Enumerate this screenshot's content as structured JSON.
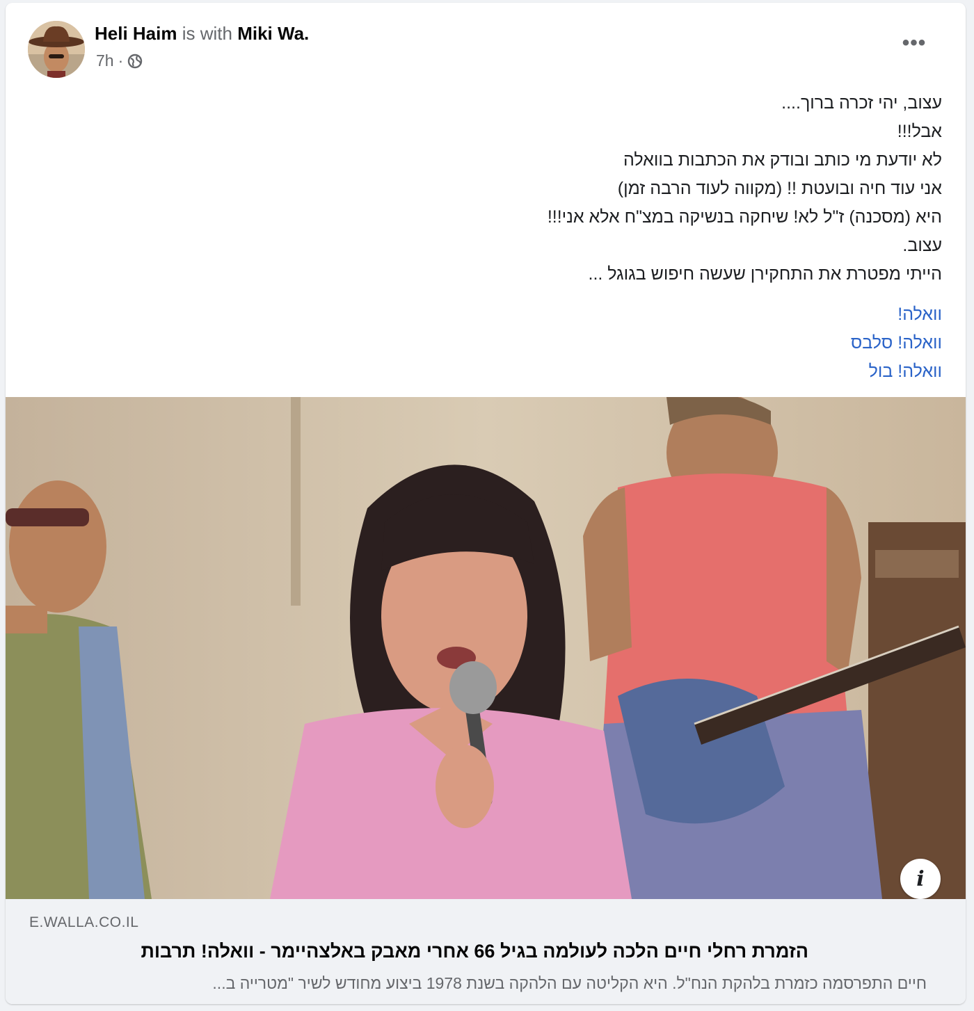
{
  "post": {
    "author": "Heli Haim",
    "with_text": "is with",
    "tagged": "Miki Wa.",
    "time": "7h",
    "separator": "·",
    "privacy_icon": "globe-icon",
    "more_icon": "more-horizontal-icon",
    "more_label": "•••",
    "text_lines": [
      "עצוב, יהי זכרה ברוך....",
      "אבל!!!",
      "לא יודעת מי כותב ובודק את הכתבות בוואלה",
      "אני עוד חיה ובועטת !! (מקווה לעוד הרבה זמן)",
      "היא (מסכנה) ז\"ל לא!  שיחקה בנשיקה במצ\"ח אלא אני!!!",
      "עצוב.",
      "הייתי מפטרת את התחקירן שעשה חיפוש בגוגל ..."
    ],
    "hashtags": [
      "וואלה!",
      "וואלה! סלבס",
      "וואלה! בול"
    ],
    "link_color": "#2a63c8"
  },
  "media": {
    "info_label": "i"
  },
  "link_preview": {
    "domain": "E.WALLA.CO.IL",
    "title": "הזמרת רחלי חיים הלכה לעולמה בגיל 66 אחרי מאבק באלצהיימר - וואלה! תרבות",
    "description": "חיים התפרסמה כזמרת בלהקת הנח\"ל. היא הקליטה עם הלהקה בשנת 1978 ביצוע מחודש לשיר \"מטרייה ב..."
  }
}
